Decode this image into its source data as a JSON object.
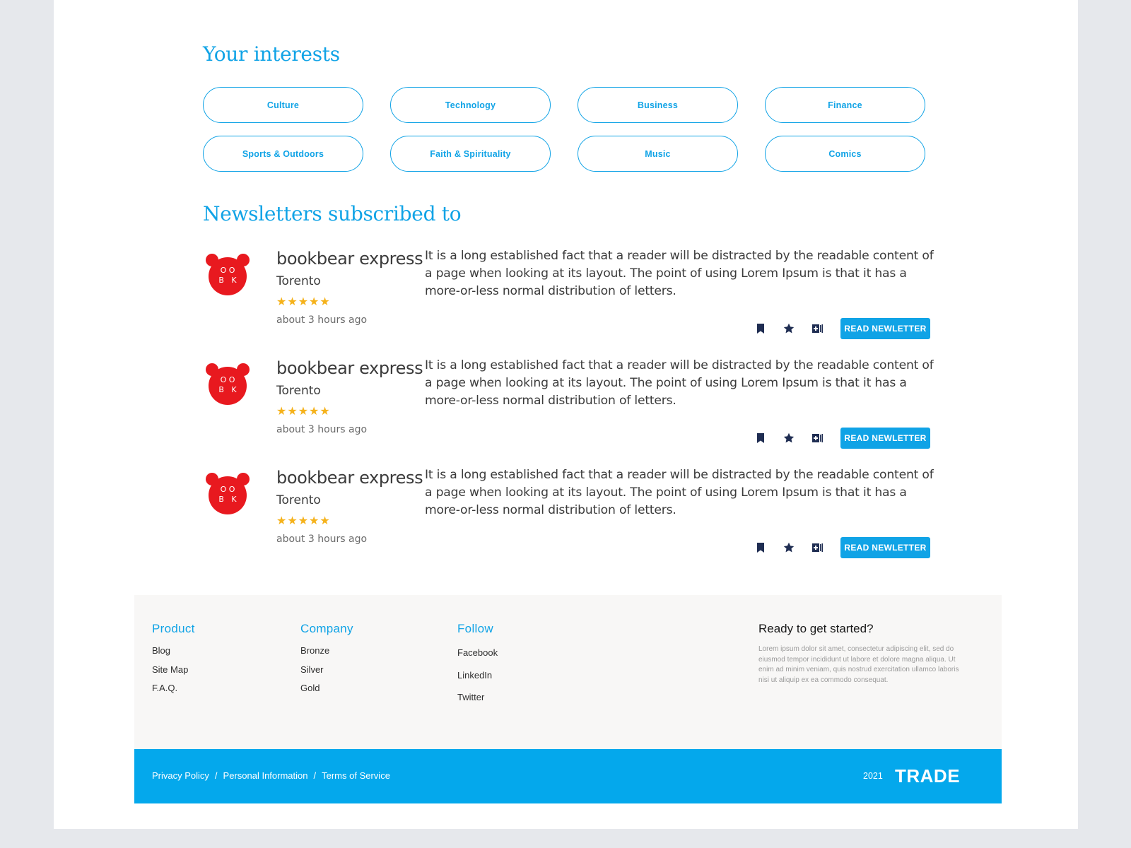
{
  "interests": {
    "title": "Your interests",
    "items": [
      "Culture",
      "Technology",
      "Business",
      "Finance",
      "Sports & Outdoors",
      "Faith & Spirituality",
      "Music",
      "Comics"
    ]
  },
  "newsletters": {
    "title": "Newsletters subscribed to",
    "items": [
      {
        "logo_text_top": "O O",
        "logo_text_bottom": "B   K",
        "name": "bookbear express",
        "city": "Torento",
        "rating": "★★★★★",
        "time": "about 3 hours ago",
        "description": "It is a long established fact that a reader will be distracted by the readable content of a page when looking at its layout. The point of using Lorem Ipsum is that it has a more-or-less normal distribution of letters.",
        "button": "READ NEWLETTER"
      },
      {
        "logo_text_top": "O O",
        "logo_text_bottom": "B   K",
        "name": "bookbear express",
        "city": "Torento",
        "rating": "★★★★★",
        "time": "about 3 hours ago",
        "description": "It is a long established fact that a reader will be distracted by the readable content of a page when looking at its layout. The point of using Lorem Ipsum is that it has a more-or-less normal distribution of letters.",
        "button": "READ NEWLETTER"
      },
      {
        "logo_text_top": "O O",
        "logo_text_bottom": "B   K",
        "name": "bookbear express",
        "city": "Torento",
        "rating": "★★★★★",
        "time": "about 3 hours ago",
        "description": "It is a long established fact that a reader will be distracted by the readable content of a page when looking at its layout. The point of using Lorem Ipsum is that it has a more-or-less normal distribution of letters.",
        "button": "READ NEWLETTER"
      }
    ]
  },
  "footer": {
    "product": {
      "title": "Product",
      "links": [
        "Blog",
        "Site Map",
        "F.A.Q."
      ]
    },
    "company": {
      "title": "Company",
      "links": [
        "Bronze",
        "Silver",
        "Gold"
      ]
    },
    "follow": {
      "title": "Follow",
      "links": [
        "Facebook",
        "LinkedIn",
        "Twitter"
      ]
    },
    "cta": {
      "title": "Ready to get started?",
      "text": "Lorem ipsum dolor sit amet, consectetur adipiscing elit, sed do eiusmod tempor incididunt ut labore et dolore magna aliqua. Ut enim ad minim veniam, quis nostrud exercitation ullamco laboris nisi ut aliquip ex ea commodo consequat."
    }
  },
  "bottom_bar": {
    "links": [
      "Privacy Policy",
      "Personal Information",
      "Terms of Service"
    ],
    "separator": "/",
    "year": "2021",
    "brand": "TRADE"
  },
  "colors": {
    "accent": "#10a3e6",
    "bar": "#04a8ec",
    "logo": "#e8191f",
    "stars": "#f5b21b",
    "icons": "#1f2d52"
  },
  "icons": [
    "bookmark-icon",
    "star-icon",
    "add-to-collection-icon"
  ]
}
